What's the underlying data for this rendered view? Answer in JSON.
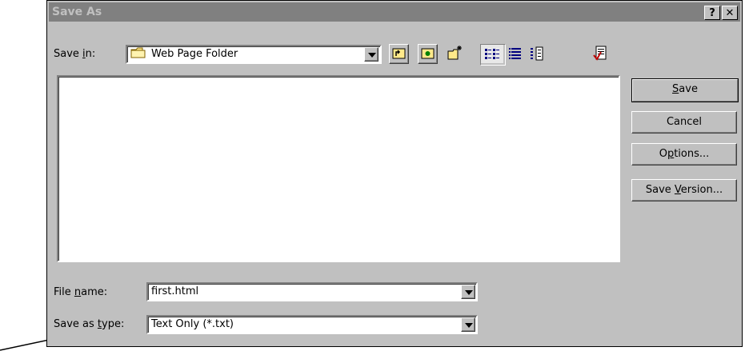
{
  "dialog": {
    "title": "Save As",
    "help_label": "?",
    "close_label": "✕"
  },
  "save_in": {
    "label_prefix": "Save ",
    "label_access": "i",
    "label_suffix": "n:",
    "value": "Web Page Folder"
  },
  "toolbar": [
    {
      "icon": "up-one-level-icon"
    },
    {
      "icon": "search-web-icon"
    },
    {
      "icon": "create-new-folder-icon"
    },
    {
      "icon": "list-view-icon"
    },
    {
      "icon": "details-view-icon"
    },
    {
      "icon": "properties-view-icon"
    },
    {
      "icon": "commands-settings-icon"
    }
  ],
  "buttons": {
    "save_access": "S",
    "save_rest": "ave",
    "cancel": "Cancel",
    "options_pre": "O",
    "options_access": "p",
    "options_rest": "tions...",
    "save_version_pre": "Save ",
    "save_version_access": "V",
    "save_version_rest": "ersion..."
  },
  "file_name": {
    "label_pre": "File ",
    "label_access": "n",
    "label_rest": "ame:",
    "value": "first.html"
  },
  "save_as_type": {
    "label_pre": "Save as ",
    "label_access": "t",
    "label_rest": "ype:",
    "value": "Text Only (*.txt)"
  }
}
